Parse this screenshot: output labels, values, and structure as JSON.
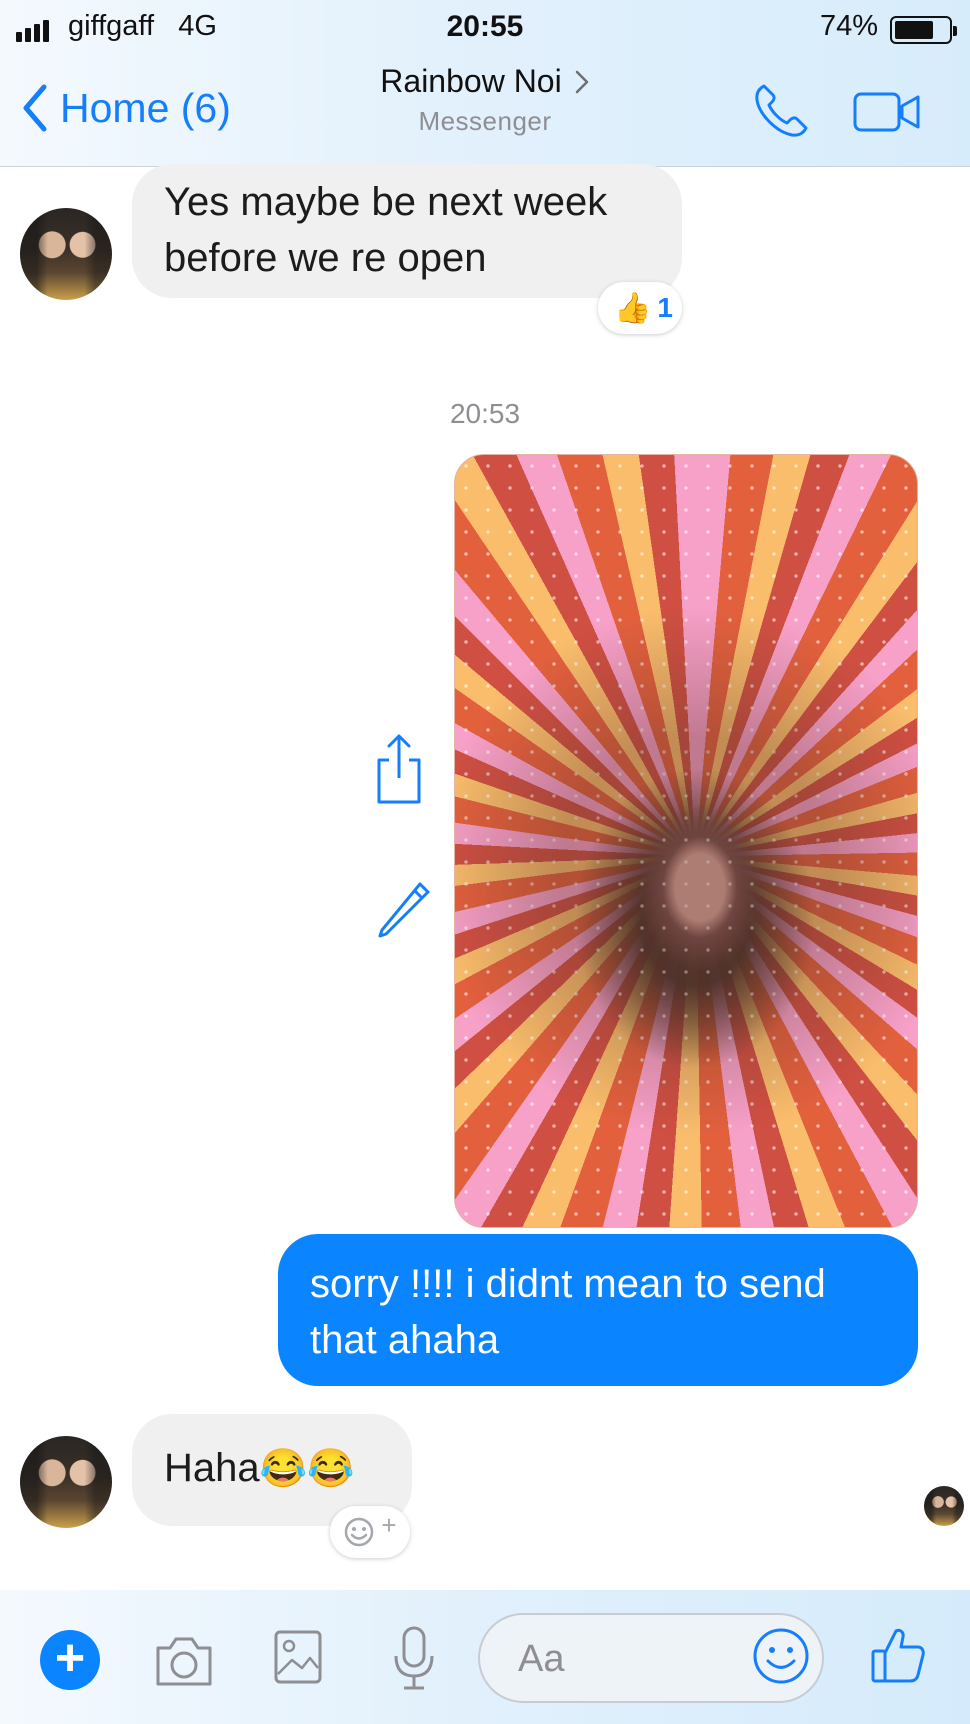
{
  "status_bar": {
    "carrier": "giffgaff",
    "network": "4G",
    "time": "20:55",
    "battery_percent": "74%",
    "battery_level": 0.74
  },
  "header": {
    "back_label": "Home (6)",
    "contact_name": "Rainbow Noi",
    "subtitle": "Messenger"
  },
  "messages": [
    {
      "direction": "incoming",
      "text_lines": [
        "Yes maybe be next week",
        "before we re open"
      ],
      "reaction": {
        "icon": "thumbs-up",
        "count": "1"
      }
    },
    {
      "direction": "timestamp",
      "text": "20:53"
    },
    {
      "direction": "outgoing",
      "type": "photo"
    },
    {
      "direction": "outgoing",
      "text_lines": [
        "sorry !!!! i didnt mean to send",
        "that ahaha"
      ]
    },
    {
      "direction": "incoming",
      "text": "Haha",
      "emojis": "😂😂"
    }
  ],
  "add_reaction_plus": "+",
  "composer": {
    "placeholder": "Aa",
    "value": ""
  },
  "colors": {
    "accent": "#0a84ff",
    "incoming_bubble": "#f0f0f0",
    "header_bg": "#e3f1fc"
  },
  "icons": [
    "share-icon",
    "edit-icon",
    "phone-icon",
    "video-camera-icon",
    "camera-icon",
    "gallery-icon",
    "microphone-icon",
    "emoji-icon",
    "thumbs-up-icon"
  ]
}
